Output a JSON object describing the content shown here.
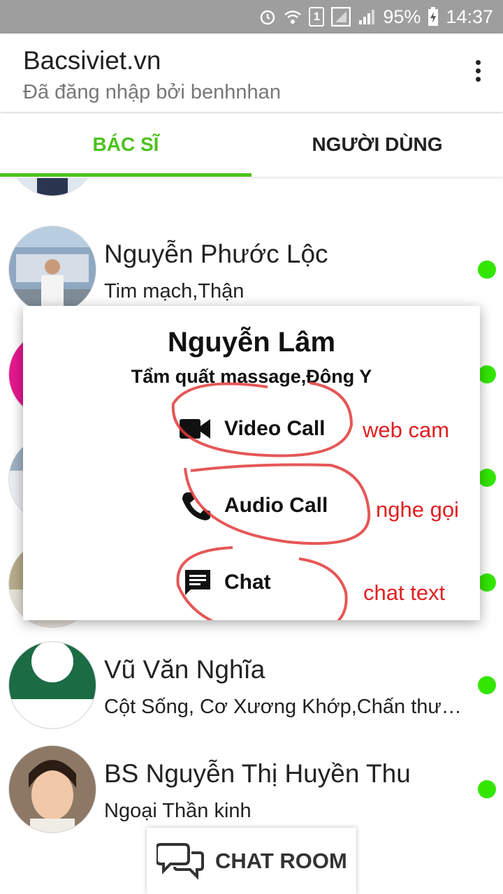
{
  "status_bar": {
    "battery": "95%",
    "time": "14:37",
    "sim": "1"
  },
  "app_bar": {
    "title": "Bacsiviet.vn",
    "subtitle": "Đã đăng nhập bởi benhnhan"
  },
  "tabs": [
    {
      "label": "BÁC SĨ",
      "active": true
    },
    {
      "label": "NGƯỜI DÙNG",
      "active": false
    }
  ],
  "doctors": [
    {
      "name": "Nguyễn Phước Lộc",
      "specialty": "Tim  mạch,Thận",
      "online": true
    },
    {
      "name": "Vũ Văn Nghĩa",
      "specialty": "Cột Sống, Cơ Xương Khớp,Chấn thương chỉnh hình",
      "online": true
    },
    {
      "name": "BS Nguyễn Thị Huyền Thu",
      "specialty": "Ngoại Thần kinh",
      "online": true
    }
  ],
  "dialog": {
    "name": "Nguyễn Lâm",
    "specialty": "Tẩm quất massage,Đông Y",
    "actions": [
      {
        "label": "Video Call",
        "icon": "video-camera-icon",
        "annotation": "web cam"
      },
      {
        "label": "Audio Call",
        "icon": "phone-icon",
        "annotation": "nghe gọi"
      },
      {
        "label": "Chat",
        "icon": "message-icon",
        "annotation": "chat text"
      }
    ]
  },
  "chat_room": {
    "label": "CHAT ROOM",
    "icon": "chat-bubbles-icon"
  },
  "colors": {
    "accent_green": "#4cc21c",
    "online_dot": "#33e600",
    "annotation_red": "#e02020",
    "status_bar": "#9e9e9e"
  }
}
